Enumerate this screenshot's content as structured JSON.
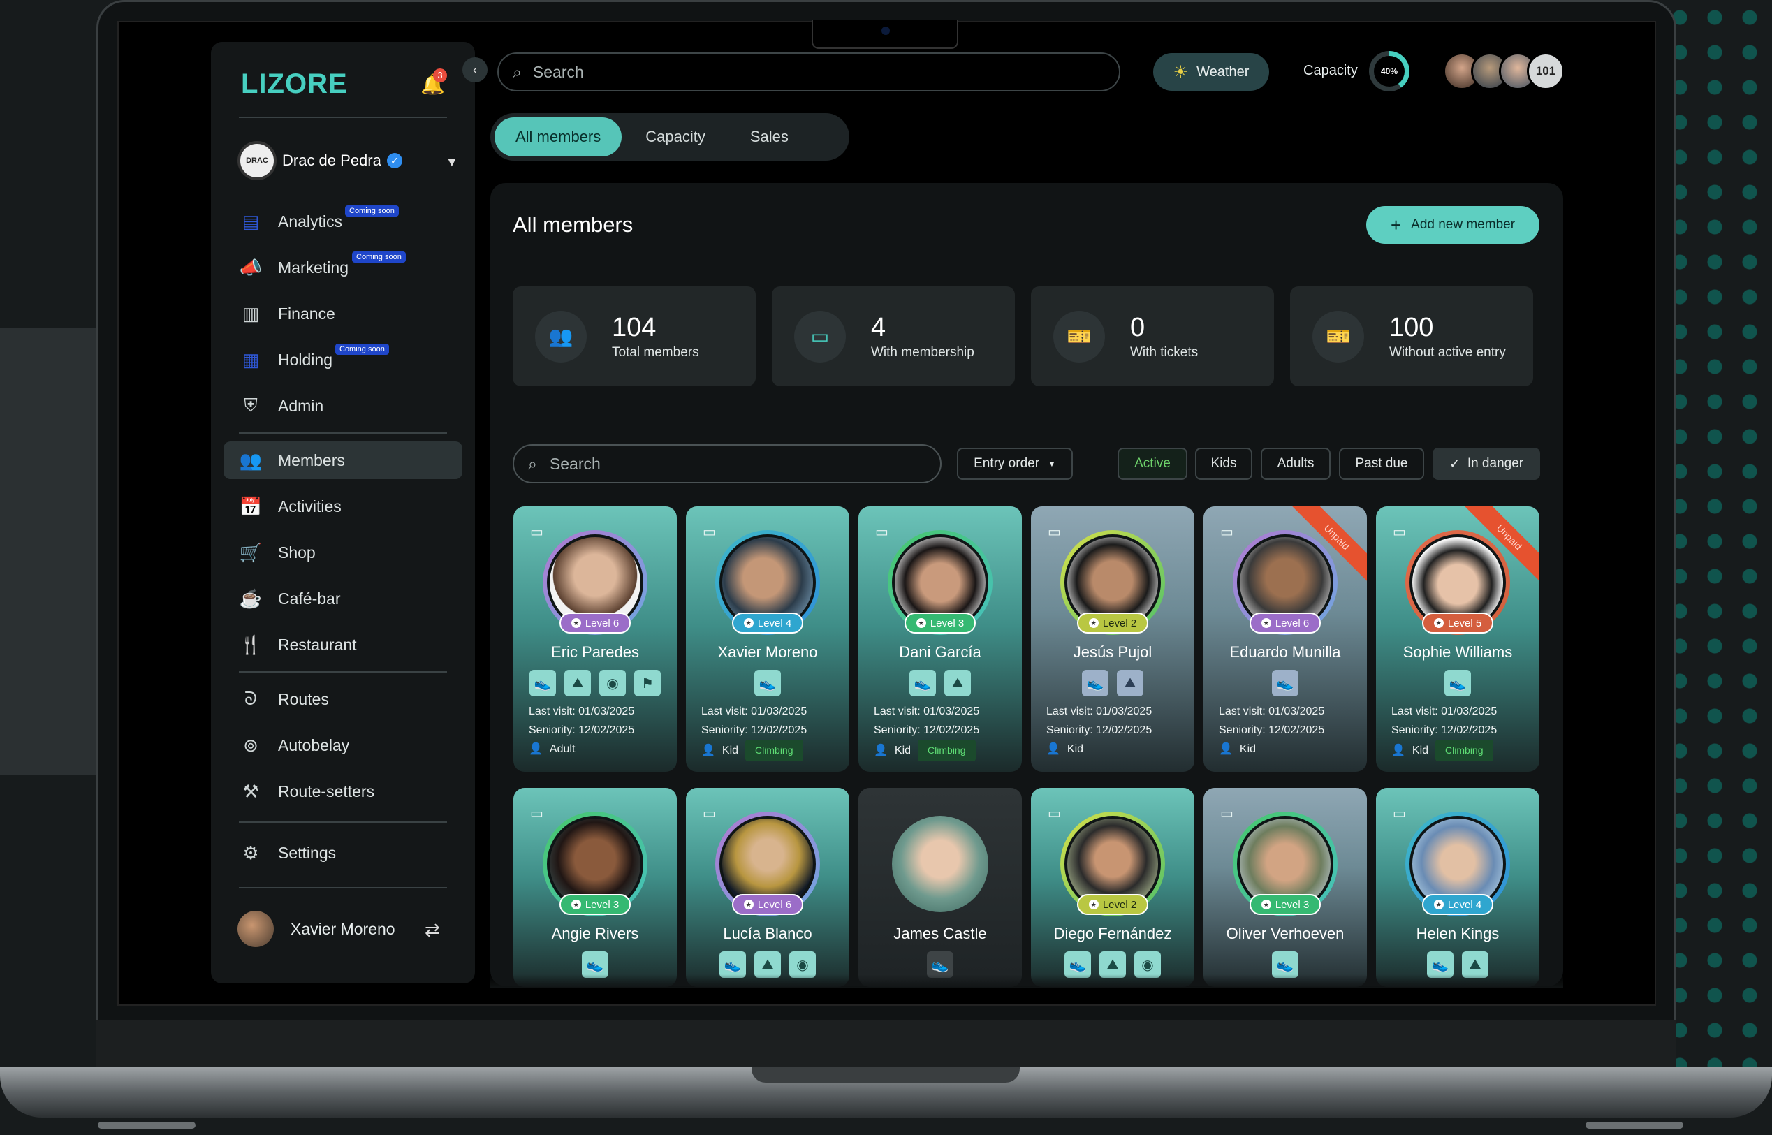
{
  "app": {
    "logo": "LIZORE",
    "notification_count": "3"
  },
  "gym": {
    "name": "Drac de Pedra",
    "avatar_text": "DRAC"
  },
  "sidebar": {
    "items": [
      {
        "label": "Analytics",
        "icon": "analytics-icon",
        "badge": "Coming soon"
      },
      {
        "label": "Marketing",
        "icon": "megaphone-icon",
        "badge": "Coming soon"
      },
      {
        "label": "Finance",
        "icon": "bar-chart-icon"
      },
      {
        "label": "Holding",
        "icon": "building-icon",
        "badge": "Coming soon"
      },
      {
        "label": "Admin",
        "icon": "admin-icon"
      },
      {
        "label": "Members",
        "icon": "members-icon",
        "active": true
      },
      {
        "label": "Activities",
        "icon": "calendar-icon"
      },
      {
        "label": "Shop",
        "icon": "cart-icon"
      },
      {
        "label": "Café-bar",
        "icon": "coffee-icon"
      },
      {
        "label": "Restaurant",
        "icon": "cutlery-icon"
      },
      {
        "label": "Routes",
        "icon": "routes-icon"
      },
      {
        "label": "Autobelay",
        "icon": "autobelay-icon"
      },
      {
        "label": "Route-setters",
        "icon": "drill-icon"
      },
      {
        "label": "Settings",
        "icon": "gear-icon"
      }
    ],
    "user": {
      "name": "Xavier Moreno"
    }
  },
  "topbar": {
    "search_placeholder": "Search",
    "weather_label": "Weather",
    "capacity_label": "Capacity",
    "capacity_value": "40%",
    "capacity_fraction": 0.4,
    "online_count": "101"
  },
  "tabs": [
    "All members",
    "Capacity",
    "Sales"
  ],
  "main": {
    "title": "All members",
    "add_button": "Add new member",
    "stats": [
      {
        "value": "104",
        "label": "Total members",
        "icon": "members-icon"
      },
      {
        "value": "4",
        "label": "With membership",
        "icon": "membership-icon"
      },
      {
        "value": "0",
        "label": "With tickets",
        "icon": "ticket-icon"
      },
      {
        "value": "100",
        "label": "Without active entry",
        "icon": "ticket-icon"
      }
    ],
    "search_placeholder": "Search",
    "sort_label": "Entry order",
    "filters": [
      "Active",
      "Kids",
      "Adults",
      "Past due",
      "In danger"
    ]
  },
  "members": [
    {
      "name": "Eric Paredes",
      "level": "Level 6",
      "last_visit": "Last visit: 01/03/2025",
      "seniority": "Seniority: 12/02/2025",
      "type": "Adult",
      "activities": 4
    },
    {
      "name": "Xavier Moreno",
      "level": "Level 4",
      "last_visit": "Last visit: 01/03/2025",
      "seniority": "Seniority: 12/02/2025",
      "type": "Kid",
      "tag": "Climbing",
      "activities": 1
    },
    {
      "name": "Dani García",
      "level": "Level 3",
      "last_visit": "Last visit: 01/03/2025",
      "seniority": "Seniority: 12/02/2025",
      "type": "Kid",
      "tag": "Climbing",
      "activities": 2
    },
    {
      "name": "Jesús Pujol",
      "level": "Level 2",
      "last_visit": "Last visit: 01/03/2025",
      "seniority": "Seniority: 12/02/2025",
      "type": "Kid",
      "activities": 2
    },
    {
      "name": "Eduardo Munilla",
      "level": "Level 6",
      "last_visit": "Last visit: 01/03/2025",
      "seniority": "Seniority: 12/02/2025",
      "type": "Kid",
      "ribbon": "Unpaid",
      "activities": 1
    },
    {
      "name": "Sophie Williams",
      "level": "Level 5",
      "last_visit": "Last visit: 01/03/2025",
      "seniority": "Seniority: 12/02/2025",
      "type": "Kid",
      "tag": "Climbing",
      "ribbon": "Unpaid",
      "activities": 1
    },
    {
      "name": "Angie Rivers",
      "level": "Level 3"
    },
    {
      "name": "Lucía Blanco",
      "level": "Level 6"
    },
    {
      "name": "James Castle"
    },
    {
      "name": "Diego Fernández",
      "level": "Level 2"
    },
    {
      "name": "Oliver Verhoeven",
      "level": "Level 3"
    },
    {
      "name": "Helen Kings",
      "level": "Level 4"
    }
  ]
}
